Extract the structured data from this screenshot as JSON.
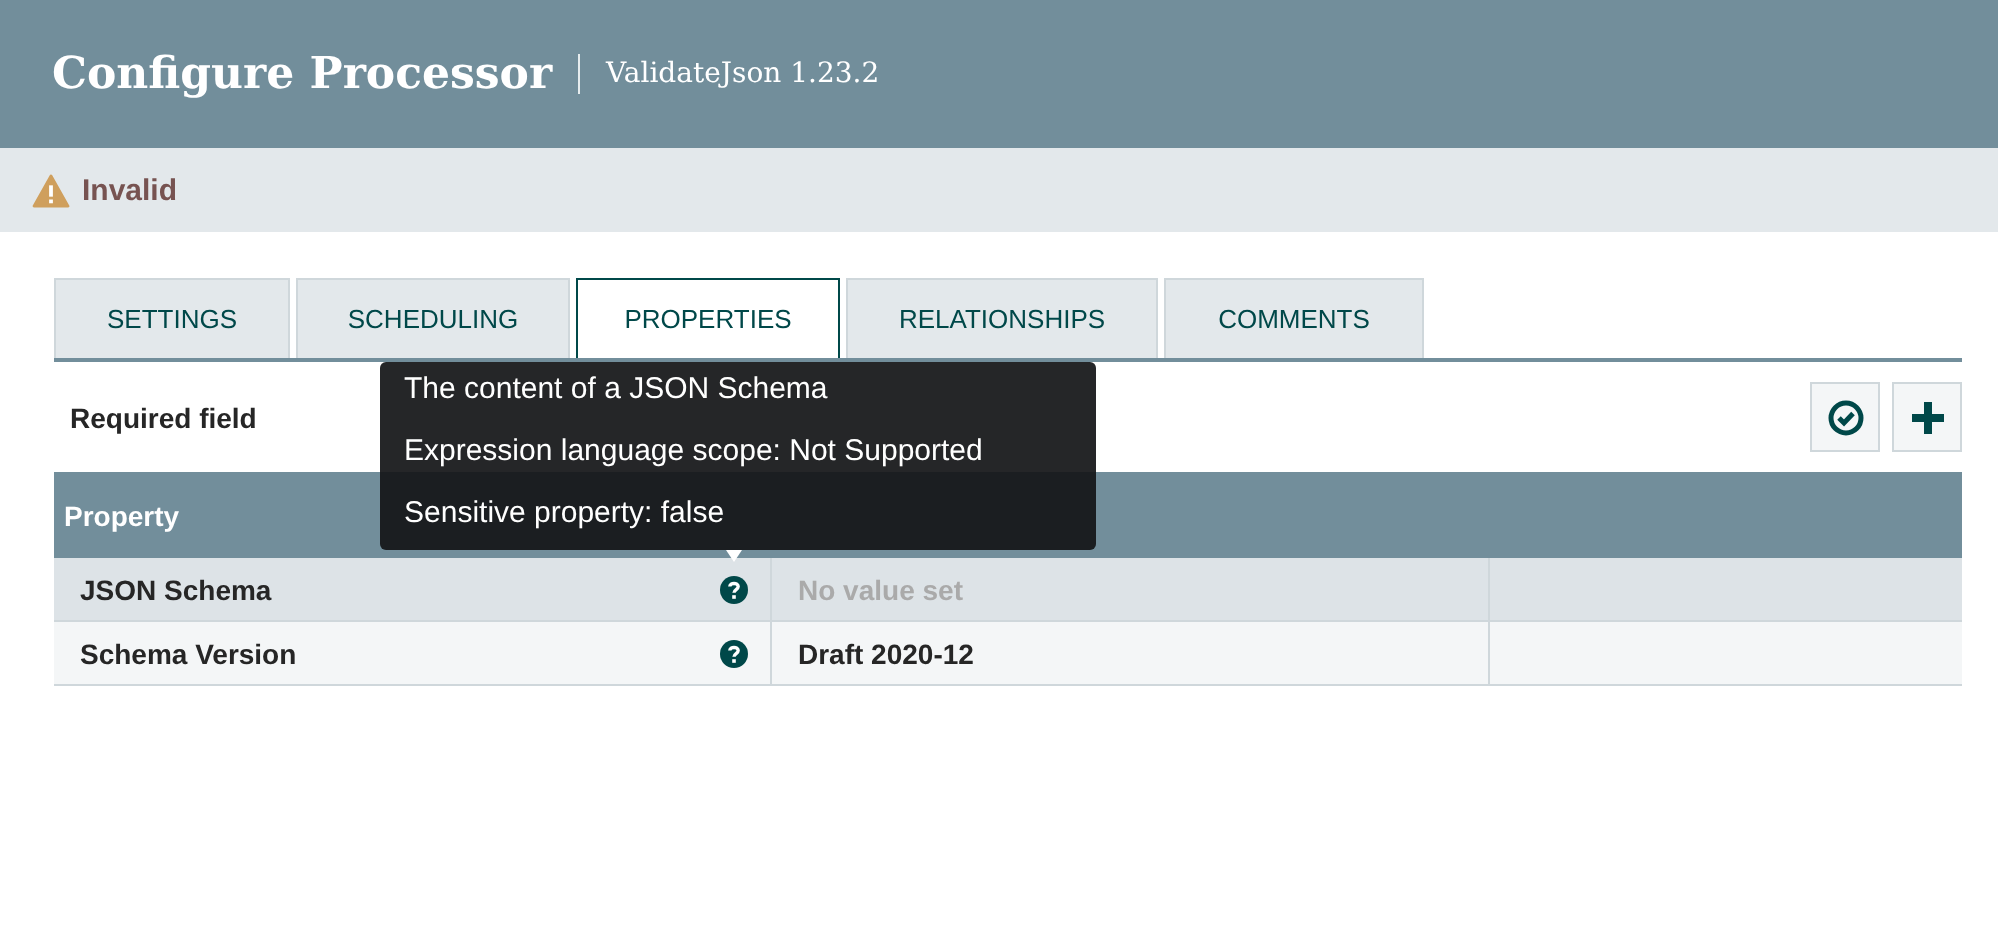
{
  "header": {
    "title": "Configure Processor",
    "subtitle": "ValidateJson 1.23.2"
  },
  "status": {
    "label": "Invalid"
  },
  "tabs": [
    {
      "label": "SETTINGS",
      "selected": false
    },
    {
      "label": "SCHEDULING",
      "selected": false
    },
    {
      "label": "PROPERTIES",
      "selected": true
    },
    {
      "label": "RELATIONSHIPS",
      "selected": false
    },
    {
      "label": "COMMENTS",
      "selected": false
    }
  ],
  "required_label": "Required field",
  "table": {
    "columns": [
      "Property"
    ],
    "rows": [
      {
        "property": "JSON Schema",
        "value": "No value set",
        "value_set": false
      },
      {
        "property": "Schema Version",
        "value": "Draft 2020-12",
        "value_set": true
      }
    ]
  },
  "tooltip": {
    "lines": [
      "The content of a JSON Schema",
      "Expression language scope: Not Supported",
      "Sensitive property: false"
    ]
  }
}
